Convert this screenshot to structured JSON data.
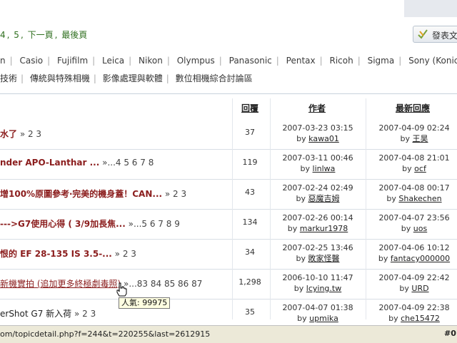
{
  "pager": {
    "items": [
      "4",
      ",",
      "5",
      ",",
      "下一頁",
      ",",
      "最後頁"
    ]
  },
  "post_button": {
    "label": "發表文"
  },
  "brands": [
    "n",
    "Casio",
    "Fujifilm",
    "Leica",
    "Nikon",
    "Olympus",
    "Panasonic",
    "Pentax",
    "Ricoh",
    "Sigma",
    "Sony (Konica"
  ],
  "subforums": [
    "技術",
    "傳統與特殊相機",
    "影像處理與軟體",
    "數位相機綜合討論區"
  ],
  "headers": {
    "replies": "回覆",
    "author": "作者",
    "latest": "最新回應"
  },
  "rows": [
    {
      "title": "水了",
      "pages": " » 2 3",
      "replies": "37",
      "author_date": "2007-03-23 03:15",
      "author": "kawa01",
      "latest_date": "2007-04-09 02:24",
      "latest_by": "王昊"
    },
    {
      "title": "nder APO-Lanthar ...",
      "pages": " »...4 5 6 7 8",
      "replies": "119",
      "author_date": "2007-03-11 00:46",
      "author": "linlwa",
      "latest_date": "2007-04-08 21:01",
      "latest_by": "ocf"
    },
    {
      "title": "增100%原圖參考‧完美的機身蓋！CAN...",
      "pages": " » 2 3",
      "replies": "43",
      "author_date": "2007-02-24 02:49",
      "author": "惡魔吉姆",
      "latest_date": "2007-04-08 00:17",
      "latest_by": "Shakechen"
    },
    {
      "title": "--->G7使用心得 ( 3/9加長焦...",
      "pages": " »...5 6 7 8 9",
      "replies": "134",
      "author_date": "2007-02-26 00:14",
      "author": "markur1978",
      "latest_date": "2007-04-07 23:56",
      "latest_by": "uos"
    },
    {
      "title": "恨的 EF 28-135 IS 3.5-...",
      "pages": " » 2 3",
      "replies": "34",
      "author_date": "2007-02-25 13:46",
      "author": "敗家怪醫",
      "latest_date": "2007-04-06 10:12",
      "latest_by": "fantacy000000"
    },
    {
      "title": "新機實拍 (追加更多終極劇毒照)",
      "pages": " »...83 84 85 86 87",
      "replies": "1,298",
      "author_date": "2006-10-10 11:47",
      "author": "lcying.tw",
      "latest_date": "2007-04-09 22:42",
      "latest_by": "URD"
    },
    {
      "title": "erShot G7 新入荷",
      "pages": " » 2 3",
      "replies": "35",
      "author_date": "2007-04-07 01:38",
      "author": "upmika",
      "latest_date": "2007-04-09 22:38",
      "latest_by": "che15472"
    }
  ],
  "tooltip": "人氣: 99975",
  "status": {
    "url": "om/topicdetail.php?f=244&t=220255&last=2612915",
    "zoom": "#0"
  }
}
